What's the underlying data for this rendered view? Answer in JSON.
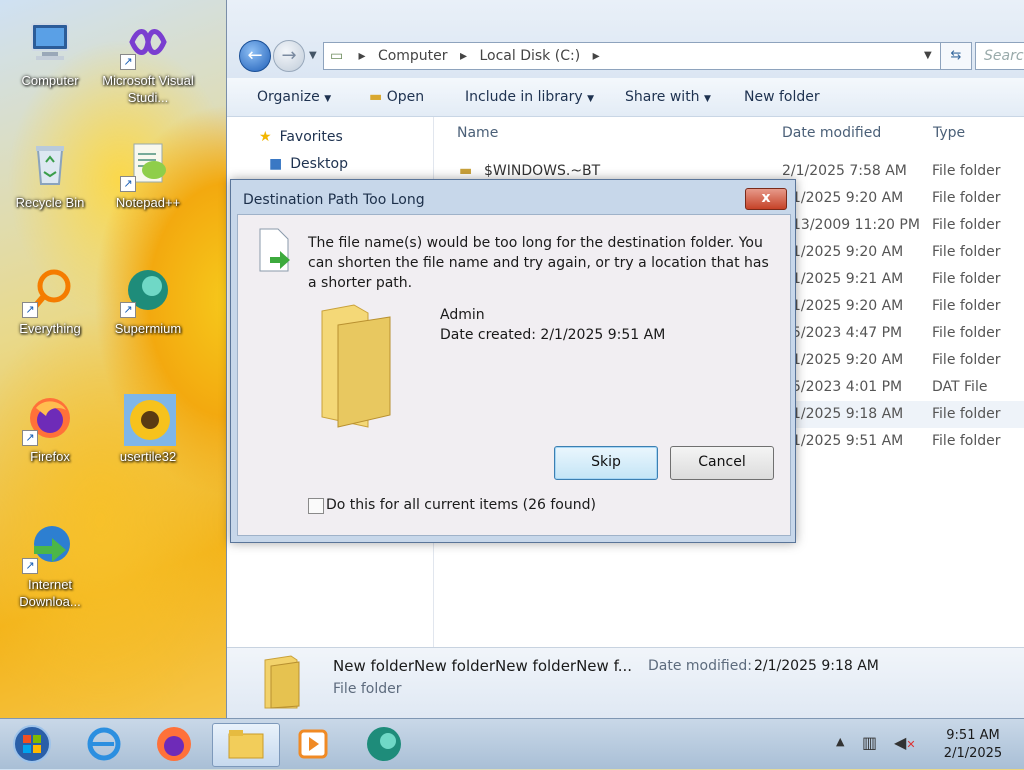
{
  "desktop": {
    "icons": [
      {
        "label": "Computer"
      },
      {
        "label": "Microsoft Visual Studi..."
      },
      {
        "label": "Recycle Bin"
      },
      {
        "label": "Notepad++"
      },
      {
        "label": "Everything"
      },
      {
        "label": "Supermium"
      },
      {
        "label": "Firefox"
      },
      {
        "label": "usertile32"
      },
      {
        "label": "Internet Downloa..."
      }
    ]
  },
  "explorer": {
    "breadcrumb": [
      "Computer",
      "Local Disk (C:)"
    ],
    "search_placeholder": "Search",
    "toolbar": {
      "organize": "Organize",
      "open": "Open",
      "include_in_library": "Include in library",
      "share_with": "Share with",
      "new_folder": "New folder"
    },
    "nav": {
      "favorites": "Favorites",
      "desktop": "Desktop"
    },
    "columns": {
      "name": "Name",
      "date_modified": "Date modified",
      "type": "Type"
    },
    "rows": [
      {
        "name": "$WINDOWS.~BT",
        "date": "2/1/2025 7:58 AM",
        "type": "File folder"
      },
      {
        "name": "",
        "date": "1/2025 9:20 AM",
        "type": "File folder"
      },
      {
        "name": "",
        "date": "13/2009 11:20 PM",
        "type": "File folder"
      },
      {
        "name": "",
        "date": "1/2025 9:20 AM",
        "type": "File folder"
      },
      {
        "name": "",
        "date": "1/2025 9:21 AM",
        "type": "File folder"
      },
      {
        "name": "",
        "date": "1/2025 9:20 AM",
        "type": "File folder"
      },
      {
        "name": "",
        "date": "5/2023 4:47 PM",
        "type": "File folder"
      },
      {
        "name": "",
        "date": "1/2025 9:20 AM",
        "type": "File folder"
      },
      {
        "name": "",
        "date": "5/2023 4:01 PM",
        "type": "DAT File"
      },
      {
        "name": "",
        "date": "1/2025 9:18 AM",
        "type": "File folder"
      },
      {
        "name": "",
        "date": "1/2025 9:51 AM",
        "type": "File folder"
      }
    ],
    "details": {
      "name": "New folderNew folderNew folderNew f...",
      "date_label": "Date modified:",
      "date_value": "2/1/2025 9:18 AM",
      "type": "File folder"
    }
  },
  "dialog": {
    "title": "Destination Path Too Long",
    "close": "x",
    "message": "The file name(s) would be too long for the destination folder.  You can shorten the file name and try again, or try a location that has a shorter path.",
    "item_name": "Admin",
    "item_date": "Date created: 2/1/2025 9:51 AM",
    "skip_label": "Skip",
    "cancel_label": "Cancel",
    "checkbox_label": "Do this for all current items (26 found)",
    "checkbox_checked": false
  },
  "taskbar": {
    "time": "9:51 AM",
    "date": "2/1/2025"
  }
}
